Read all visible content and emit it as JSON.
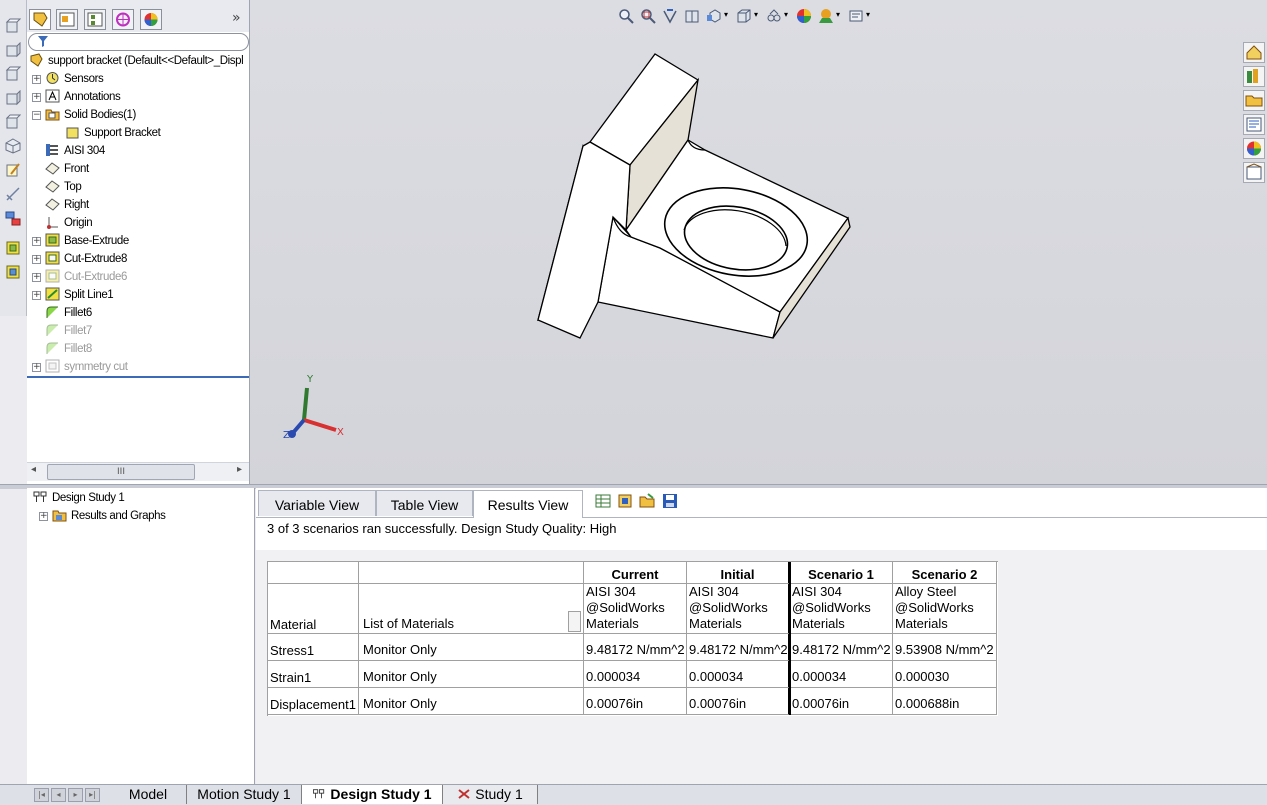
{
  "feature_tree": {
    "panel_expand": "»",
    "root": "support bracket  (Default<<Default>_Displ",
    "items": [
      {
        "label": "Sensors",
        "icon": "sensors-icon",
        "expander": "+",
        "disabled": false
      },
      {
        "label": "Annotations",
        "icon": "annotations-icon",
        "expander": "+",
        "disabled": false
      },
      {
        "label": "Solid Bodies(1)",
        "icon": "solid-bodies-folder-icon",
        "expander": "−",
        "disabled": false
      },
      {
        "label": "Support Bracket",
        "icon": "solid-body-icon",
        "expander": "",
        "disabled": false
      },
      {
        "label": "AISI 304",
        "icon": "material-icon",
        "expander": "",
        "disabled": false
      },
      {
        "label": "Front",
        "icon": "plane-icon",
        "expander": "",
        "disabled": false
      },
      {
        "label": "Top",
        "icon": "plane-icon",
        "expander": "",
        "disabled": false
      },
      {
        "label": "Right",
        "icon": "plane-icon",
        "expander": "",
        "disabled": false
      },
      {
        "label": "Origin",
        "icon": "origin-icon",
        "expander": "",
        "disabled": false
      },
      {
        "label": "Base-Extrude",
        "icon": "extrude-icon",
        "expander": "+",
        "disabled": false
      },
      {
        "label": "Cut-Extrude8",
        "icon": "cut-extrude-icon",
        "expander": "+",
        "disabled": false
      },
      {
        "label": "Cut-Extrude6",
        "icon": "cut-extrude-icon",
        "expander": "+",
        "disabled": true
      },
      {
        "label": "Split Line1",
        "icon": "split-line-icon",
        "expander": "+",
        "disabled": false
      },
      {
        "label": "Fillet6",
        "icon": "fillet-icon",
        "expander": "",
        "disabled": false
      },
      {
        "label": "Fillet7",
        "icon": "fillet-icon",
        "expander": "",
        "disabled": true
      },
      {
        "label": "Fillet8",
        "icon": "fillet-icon",
        "expander": "",
        "disabled": true
      },
      {
        "label": "symmetry cut",
        "icon": "cut-icon",
        "expander": "+",
        "disabled": true
      }
    ],
    "scroll_grip": "III",
    "scroll_left": "◂",
    "scroll_right": "▸"
  },
  "study_tree": {
    "root": "Design Study 1",
    "child": "Results and Graphs",
    "child_expander": "+"
  },
  "axes": {
    "x": "X",
    "y": "Y",
    "z": "Z"
  },
  "view_tabs": [
    "Variable View",
    "Table View",
    "Results View"
  ],
  "status": "3 of 3 scenarios ran successfully. Design Study Quality: High",
  "results_table": {
    "headers": [
      "",
      "",
      "Current",
      "Initial",
      "Scenario 1",
      "Scenario 2"
    ],
    "material_row": {
      "label": "Material",
      "type": "List of Materials",
      "values": [
        [
          "AISI 304",
          "@SolidWorks",
          "Materials"
        ],
        [
          "AISI 304",
          "@SolidWorks",
          "Materials"
        ],
        [
          "AISI 304",
          "@SolidWorks",
          "Materials"
        ],
        [
          "Alloy Steel",
          "@SolidWorks",
          "Materials"
        ]
      ]
    },
    "rows": [
      {
        "label": "Stress1",
        "type": "Monitor Only",
        "values": [
          "9.48172 N/mm^2",
          "9.48172 N/mm^2",
          "9.48172 N/mm^2",
          "9.53908 N/mm^2"
        ]
      },
      {
        "label": "Strain1",
        "type": "Monitor Only",
        "values": [
          "0.000034",
          "0.000034",
          "0.000034",
          "0.000030"
        ]
      },
      {
        "label": "Displacement1",
        "type": "Monitor Only",
        "values": [
          "0.00076in",
          "0.00076in",
          "0.00076in",
          "0.000688in"
        ]
      }
    ]
  },
  "bottom_tabs": [
    "Model",
    "Motion Study 1",
    "Design Study 1",
    "Study 1"
  ],
  "colors": {
    "selection_line": "#3a6ab8",
    "part_face": "#ffffff",
    "part_shadow": "#e8e4dc"
  }
}
